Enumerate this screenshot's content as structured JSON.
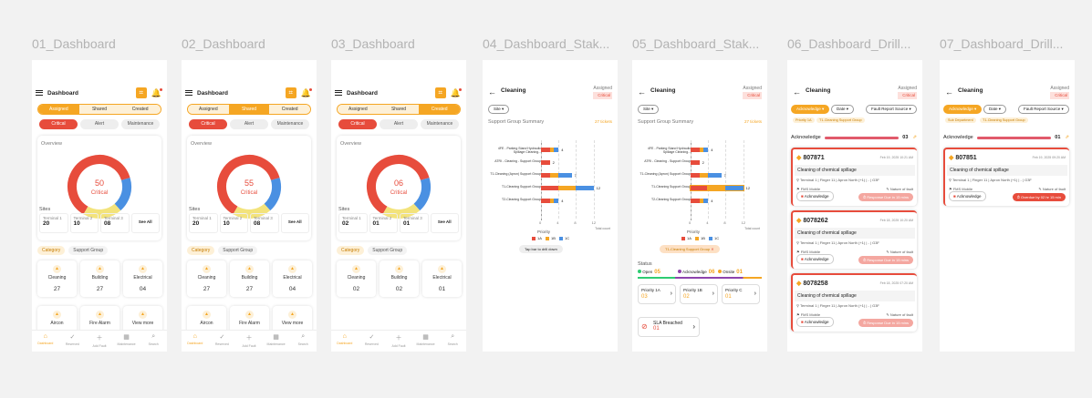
{
  "frames": [
    {
      "title": "01_Dashboard",
      "seg_active": 0,
      "center": "50"
    },
    {
      "title": "02_Dashboard",
      "seg_active": 1,
      "center": "55"
    },
    {
      "title": "03_Dashboard",
      "seg_active": 2,
      "center": "06"
    },
    {
      "title": "04_Dashboard_Stak..."
    },
    {
      "title": "05_Dashboard_Stak..."
    },
    {
      "title": "06_Dashboard_Drill..."
    },
    {
      "title": "07_Dashboard_Drill..."
    }
  ],
  "dash": {
    "title": "Dashboard",
    "tabs": [
      "Assigned",
      "Shared",
      "Created"
    ],
    "subtabs": [
      "Critical",
      "Alert",
      "Maintenance"
    ],
    "overview": "Overview",
    "critical": "Critical",
    "values": [
      "50",
      "55",
      "06"
    ],
    "sites": "Sites",
    "site_sets": [
      [
        {
          "n": "Terminal 1",
          "v": "20"
        },
        {
          "n": "Terminal 2",
          "v": "10"
        },
        {
          "n": "Terminal 3",
          "v": "08"
        }
      ],
      [
        {
          "n": "Terminal 1",
          "v": "20"
        },
        {
          "n": "Terminal 2",
          "v": "10"
        },
        {
          "n": "Terminal 3",
          "v": "08"
        }
      ],
      [
        {
          "n": "Terminal 1",
          "v": "02"
        },
        {
          "n": "Terminal 2",
          "v": "01"
        },
        {
          "n": "Terminal 3",
          "v": "01"
        }
      ]
    ],
    "see_all": "See All",
    "cat_tabs": [
      "Category",
      "Support Group"
    ],
    "cats": [
      [
        {
          "n": "Cleaning",
          "c": "27"
        },
        {
          "n": "Building",
          "c": "27"
        },
        {
          "n": "Electrical",
          "c": "04"
        },
        {
          "n": "Aircon",
          "c": ""
        },
        {
          "n": "Fire Alarm",
          "c": ""
        },
        {
          "n": "View more",
          "c": ""
        }
      ],
      [
        {
          "n": "Cleaning",
          "c": "27"
        },
        {
          "n": "Building",
          "c": "27"
        },
        {
          "n": "Electrical",
          "c": "04"
        },
        {
          "n": "Aircon",
          "c": ""
        },
        {
          "n": "Fire Alarm",
          "c": ""
        },
        {
          "n": "View more",
          "c": ""
        }
      ],
      [
        {
          "n": "Cleaning",
          "c": "02"
        },
        {
          "n": "Building",
          "c": "02"
        },
        {
          "n": "Electrical",
          "c": "01"
        }
      ]
    ],
    "nav": [
      "Dashboard",
      "Reserved",
      "Add Fault",
      "Maintenance",
      "Search"
    ]
  },
  "stak": {
    "title": "Cleaning",
    "assigned": "Assigned",
    "crit": "Critical",
    "site": "Site",
    "sgs": "Support Group Summary",
    "tickets": "27 tickets",
    "groups": [
      "4FE - Parking Stand Hydraulic Spillage Cleaning...",
      "ATRI - Cleaning - Support Group",
      "T1-Cleaning (Apron) Support Group",
      "T1-Cleaning Support Group",
      "T2-Cleaning Support Group"
    ],
    "chart_data": {
      "type": "bar",
      "categories": [
        "4FE - Parking Stand Hydraulic Spillage Cleaning...",
        "ATRI - Cleaning - Support Group",
        "T1-Cleaning (Apron) Support Group",
        "T1-Cleaning Support Group",
        "T2-Cleaning Support Group"
      ],
      "series": [
        {
          "name": "1A",
          "values": [
            2,
            2,
            2,
            4,
            2
          ]
        },
        {
          "name": "1B",
          "values": [
            1,
            0,
            2,
            4,
            1
          ]
        },
        {
          "name": "1C",
          "values": [
            1,
            0,
            3,
            4,
            1
          ]
        }
      ],
      "totals": [
        "4",
        "2",
        "7",
        "12",
        "4"
      ],
      "xticks": [
        "0",
        "4",
        "8",
        "12"
      ],
      "xlabel": "Total count"
    },
    "priority": "Priority",
    "prio": [
      "1A",
      "1B",
      "1C"
    ],
    "tap": "Tap bar to drill down",
    "filter": "T1-Cleaning Support Group",
    "status": "Status",
    "st": [
      {
        "n": "Open",
        "v": "05"
      },
      {
        "n": "Acknowledge",
        "v": "06"
      },
      {
        "n": "Onsite",
        "v": "01"
      }
    ],
    "pcards": [
      {
        "n": "Priority 1A",
        "v": "03"
      },
      {
        "n": "Priority 1B",
        "v": "02"
      },
      {
        "n": "Priority C",
        "v": "01"
      }
    ],
    "sla": "SLA Breached",
    "sla_v": "01"
  },
  "drill": {
    "title": "Cleaning",
    "assigned": "Assigned",
    "crit": "Critical",
    "dd": [
      "Acknowledge",
      "Date",
      "Fault Report Source"
    ],
    "chips6": [
      "Priority 1A",
      "T1-Cleaning Support Group"
    ],
    "chips7": [
      "Sub Department",
      "T1-Cleaning Support Group"
    ],
    "ack": "Acknowledge",
    "ack6": "03",
    "ack7": "01",
    "tickets6": [
      {
        "id": "807871",
        "dt": "Feb 19, 2025 10:21 AM",
        "ds": "Cleaning of chemical spillage",
        "loc": "Terminal 1 | Finger 11 | Apron North (+1) | - | G3F",
        "src": "FMS Mobile",
        "nat": "Nature of fault",
        "b1": "Acknowledge",
        "b2": "Response Due in 15 mins"
      },
      {
        "id": "8078262",
        "dt": "Feb 18, 2025 10:20 AM",
        "ds": "Cleaning of chemical spillage",
        "loc": "Terminal 1 | Finger 11 | Apron North (+1) | - | G3F",
        "src": "FMS Mobile",
        "nat": "Nature of fault",
        "b1": "Acknowledge",
        "b2": "Response Due in 15 mins"
      },
      {
        "id": "8078258",
        "dt": "Feb 18, 2025 07:20 AM",
        "ds": "Cleaning of chemical spillage",
        "loc": "Terminal 1 | Finger 11 | Apron North (+1) | - | G3F",
        "src": "FMS Mobile",
        "nat": "Nature of fault",
        "b1": "Acknowledge",
        "b2": "Response Due in 15 mins"
      }
    ],
    "tickets7": [
      {
        "id": "807851",
        "dt": "Feb 19, 2025 09:20 AM",
        "ds": "Cleaning of chemical spillage",
        "loc": "Terminal 1 | Finger 11 | Apron North (+1) | - | G3F",
        "src": "FMS Mobile",
        "nat": "Nature of fault",
        "b1": "Acknowledge",
        "b2": "Overdue by 02 hr 15 min"
      }
    ]
  }
}
